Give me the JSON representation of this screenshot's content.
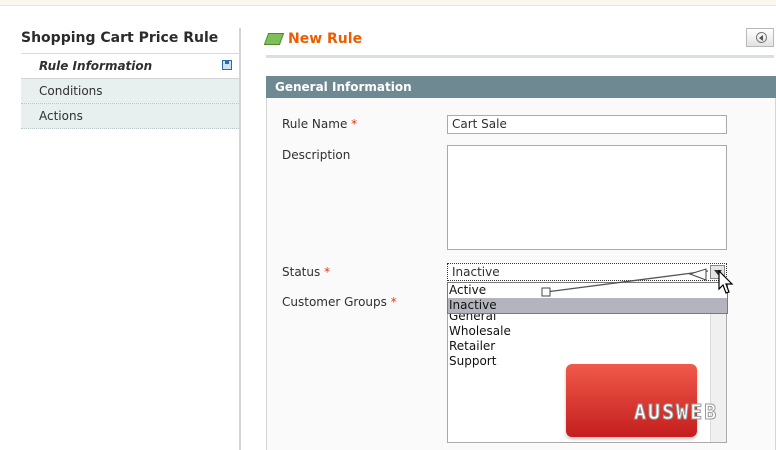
{
  "sidebar": {
    "title": "Shopping Cart Price Rule",
    "tabs": [
      {
        "label": "Rule Information",
        "active": true
      },
      {
        "label": "Conditions",
        "active": false
      },
      {
        "label": "Actions",
        "active": false
      }
    ]
  },
  "header": {
    "title": "New Rule",
    "back_icon": "back-arrow-icon",
    "rule_icon": "rule-icon"
  },
  "fieldset": {
    "title": "General Information"
  },
  "form": {
    "rule_name": {
      "label": "Rule Name",
      "required": "*",
      "value": "Cart Sale"
    },
    "description": {
      "label": "Description",
      "value": ""
    },
    "status": {
      "label": "Status",
      "required": "*",
      "value": "Inactive",
      "options": [
        "Active",
        "Inactive"
      ],
      "highlighted": "Inactive"
    },
    "customer_groups": {
      "label": "Customer Groups",
      "required": "*",
      "options": [
        "General",
        "Wholesale",
        "Retailer",
        "Support"
      ]
    }
  },
  "watermark": {
    "text": "AUSWEB"
  },
  "colors": {
    "accent": "#eb5e00",
    "fieldset_header": "#6f8992",
    "required": "#eb340a",
    "tab_inactive": "#e7efef"
  }
}
